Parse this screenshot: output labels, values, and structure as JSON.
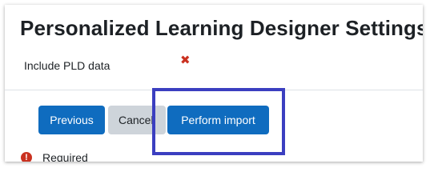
{
  "page": {
    "title": "Personalized Learning Designer Settings"
  },
  "form": {
    "include_label": "Include PLD data",
    "include_state_icon": "x-icon",
    "required_icon_glyph": "!",
    "required_text": "Required"
  },
  "buttons": {
    "previous": "Previous",
    "cancel": "Cancel",
    "perform_import": "Perform import"
  },
  "colors": {
    "primary": "#0f6cbf",
    "secondary": "#ced4da",
    "error": "#ca3120",
    "highlight": "#3b3fc0"
  }
}
